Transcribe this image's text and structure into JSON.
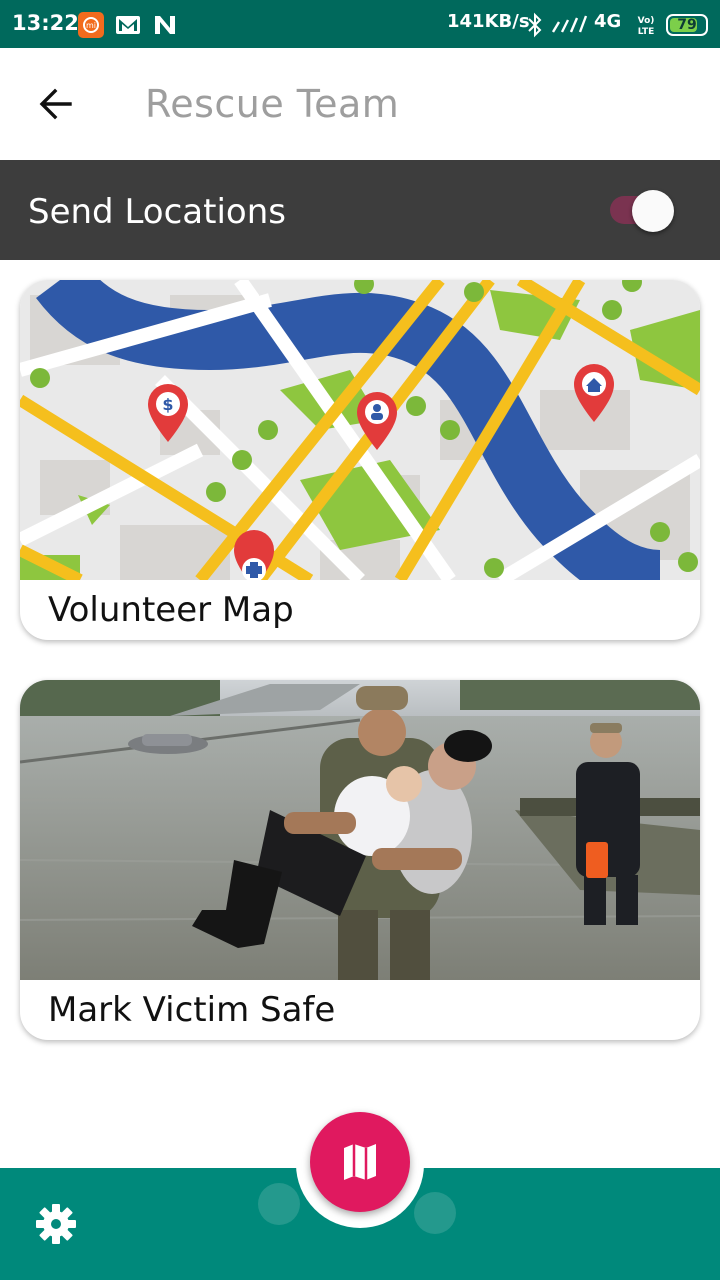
{
  "status_bar": {
    "time": "13:22",
    "network_speed": "141KB/s",
    "network_type": "4G",
    "volte": "Vo LTE",
    "battery_level": "79",
    "battery_fraction": 0.79,
    "left_icons": [
      "mi-app-icon",
      "gmail-icon",
      "n-app-icon"
    ],
    "right_icons": [
      "bluetooth-icon",
      "signal-icon",
      "volte-icon",
      "battery-icon"
    ],
    "color": "#00695c"
  },
  "app_bar": {
    "title": "Rescue Team",
    "back_icon": "arrow-left-icon"
  },
  "toggle": {
    "label": "Send Locations",
    "enabled": true
  },
  "cards": [
    {
      "title": "Volunteer Map",
      "image": "city-map-illustration"
    },
    {
      "title": "Mark Victim Safe",
      "image": "flood-rescue-photo"
    }
  ],
  "bottom_nav": {
    "fab_icon": "map-icon",
    "settings_icon": "gear-icon",
    "accent": "#e0195f",
    "bar_color": "#00897b"
  }
}
